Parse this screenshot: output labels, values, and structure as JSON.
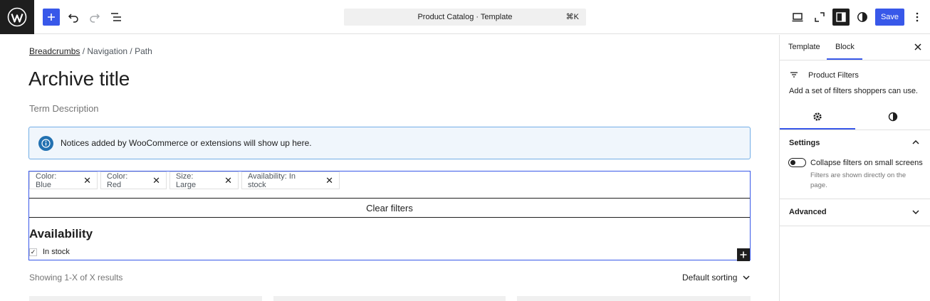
{
  "topbar": {
    "command_title": "Product Catalog · Template",
    "command_shortcut": "⌘K",
    "save_label": "Save"
  },
  "canvas": {
    "breadcrumb": {
      "link": "Breadcrumbs",
      "rest": " / Navigation / Path"
    },
    "archive_title": "Archive title",
    "term_description": "Term Description",
    "notice": "Notices added by WooCommerce or extensions will show up here.",
    "chips": [
      "Color: Blue",
      "Color: Red",
      "Size: Large",
      "Availability: In stock"
    ],
    "clear_filters": "Clear filters",
    "availability_title": "Availability",
    "in_stock_label": "In stock",
    "results_text": "Showing 1-X of X results",
    "sorting_label": "Default sorting"
  },
  "sidebar": {
    "tabs": [
      "Template",
      "Block"
    ],
    "active_tab": "Block",
    "block_title": "Product Filters",
    "block_description": "Add a set of filters shoppers can use.",
    "settings_label": "Settings",
    "toggle_label": "Collapse filters on small screens",
    "toggle_help": "Filters are shown directly on the page.",
    "advanced_label": "Advanced"
  },
  "colors": {
    "accent": "#3858e9",
    "notice_bg": "#f0f6fc",
    "notice_border": "#72aee6",
    "dark": "#1e1e1e"
  },
  "icons": [
    "wordpress-logo-icon",
    "plus-icon",
    "undo-icon",
    "redo-icon",
    "list-view-icon",
    "desktop-preview-icon",
    "fullscreen-icon",
    "sidebar-icon",
    "styles-icon",
    "more-vertical-icon",
    "info-icon",
    "close-icon",
    "check-icon",
    "filter-icon",
    "gear-icon",
    "half-circle-icon",
    "chevron-up-icon",
    "chevron-down-icon"
  ]
}
